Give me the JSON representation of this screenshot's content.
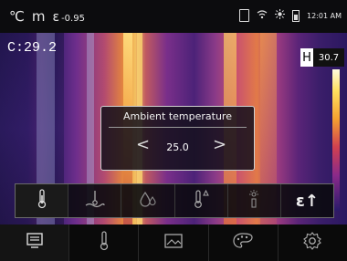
{
  "status": {
    "unit": "℃",
    "mode": "m",
    "emissivity_symbol": "ε",
    "emissivity": "-0.95",
    "time": "12:01 AM"
  },
  "view": {
    "center_temp": "C:29.2",
    "hi_label": "H",
    "hi_value": "30.7"
  },
  "dialog": {
    "title": "Ambient temperature",
    "value": "25.0",
    "prev": "<",
    "next": ">"
  },
  "params": [
    {
      "icon": "thermometer-icon",
      "selected": true
    },
    {
      "icon": "dew-point-icon"
    },
    {
      "icon": "humidity-icon"
    },
    {
      "icon": "high-temp-alarm-icon"
    },
    {
      "icon": "laser-icon"
    },
    {
      "icon": "emissivity-icon"
    }
  ],
  "emissivity_glyph": "ε↑",
  "menu": [
    {
      "icon": "display-icon",
      "active": true
    },
    {
      "icon": "thermometer-icon"
    },
    {
      "icon": "image-icon"
    },
    {
      "icon": "palette-icon"
    },
    {
      "icon": "settings-icon"
    }
  ],
  "colors": {
    "hot": "#ffe060",
    "warm": "#e27a48",
    "mid": "#8a3a88",
    "cold": "#2a1a5e"
  }
}
